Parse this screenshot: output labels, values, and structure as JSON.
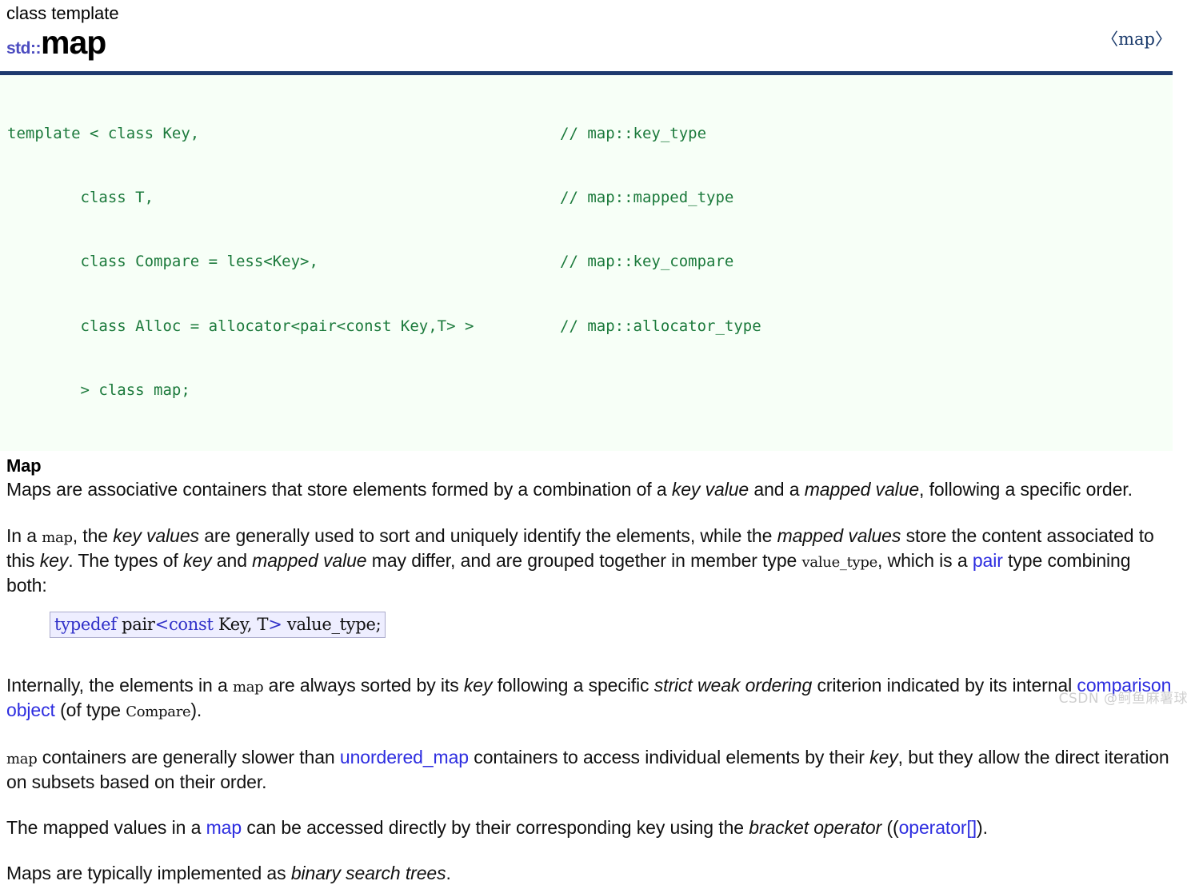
{
  "header": {
    "kind": "class template",
    "namespace": "std::",
    "name": "map",
    "include": "〈map〉"
  },
  "signature": {
    "lines": [
      {
        "code": "template < class Key,",
        "comment": "// map::key_type"
      },
      {
        "code": "        class T,",
        "comment": "// map::mapped_type"
      },
      {
        "code": "        class Compare = less<Key>,",
        "comment": "// map::key_compare"
      },
      {
        "code": "        class Alloc = allocator<pair<const Key,T> >",
        "comment": "// map::allocator_type"
      },
      {
        "code": "        > class map;",
        "comment": ""
      }
    ]
  },
  "section": {
    "title": "Map"
  },
  "paragraphs": {
    "p1": {
      "t1": "Maps are associative containers that store elements formed by a combination of a ",
      "em1": "key value",
      "t2": " and a ",
      "em2": "mapped value",
      "t3": ", following a specific order."
    },
    "p2": {
      "t1": "In a ",
      "code1": "map",
      "t2": ", the ",
      "em1": "key values",
      "t3": " are generally used to sort and uniquely identify the elements, while the ",
      "em2": "mapped values",
      "t4": " store the content associated to this ",
      "em3": "key",
      "t5": ". The types of ",
      "em4": "key",
      "t6": " and ",
      "em5": "mapped value",
      "t7": " may differ, and are grouped together in member type ",
      "code2": "value_type",
      "t8": ", which is a ",
      "link1": "pair",
      "t9": " type combining both:"
    },
    "p3": {
      "t1": "Internally, the elements in a ",
      "code1": "map",
      "t2": " are always sorted by its ",
      "em1": "key",
      "t3": " following a specific ",
      "em2": "strict weak ordering",
      "t4": " criterion indicated by its internal ",
      "link1": "comparison object",
      "t5": " (of type ",
      "code2": "Compare",
      "t6": ")."
    },
    "p4": {
      "code1": "map",
      "t1": " containers are generally slower than ",
      "link1": "unordered_map",
      "t2": " containers to access individual elements by their ",
      "em1": "key",
      "t3": ", but they allow the direct iteration on subsets based on their order."
    },
    "p5": {
      "t1": "The mapped values in a ",
      "link1": "map",
      "t2": " can be accessed directly by their corresponding key using the ",
      "em1": "bracket operator",
      "t3": " ((",
      "link2": "operator[]",
      "t4": ")."
    },
    "p6": {
      "t1": "Maps are typically implemented as ",
      "em1": "binary search trees",
      "t2": "."
    }
  },
  "typedef_box": {
    "kw1": "typedef",
    "sp1": " ",
    "name1": "pair",
    "lt": "<",
    "kw2": "const",
    "sp2": " ",
    "name2": "Key,",
    "sp3": " ",
    "name3": "T",
    "gt": ">",
    "sp4": " ",
    "name4": "value_type;"
  },
  "watermark": {
    "text": "CSDN @鲄鱼麻薯球"
  },
  "colors": {
    "rule": "#1e3a6e",
    "code_green": "#1c7a3c",
    "link_blue": "#2d2de0",
    "ns_purple": "#4c4cc0",
    "codeblock_bg": "#f7fff7",
    "typedef_bg": "#eeeeff"
  }
}
